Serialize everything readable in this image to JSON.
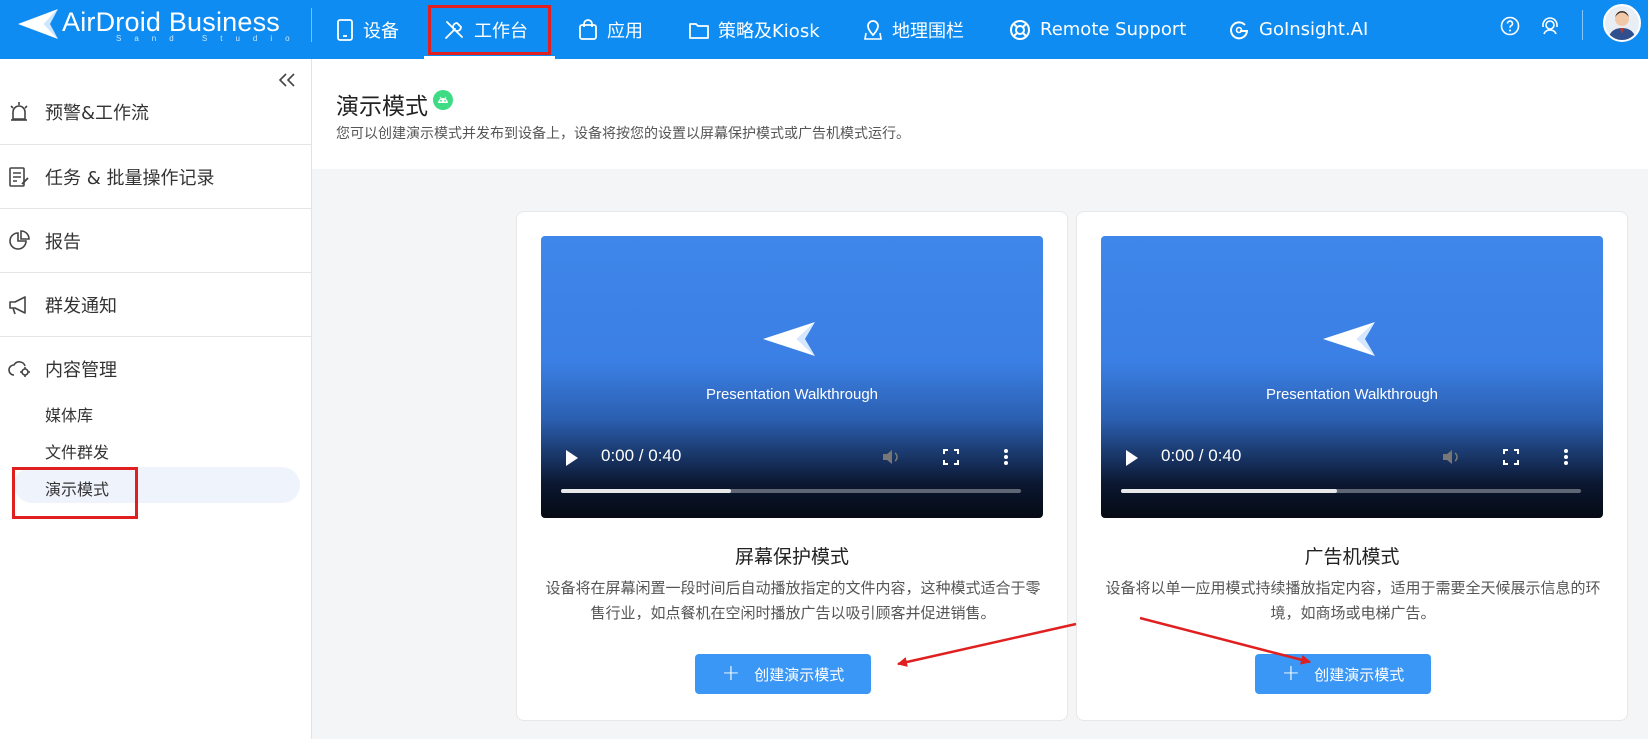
{
  "brand": {
    "name": "AirDroid Business",
    "subtitle": "Sand Studio",
    "color": "#0f8cf2"
  },
  "nav": {
    "items": [
      {
        "label": "设备",
        "icon": "tablet-icon"
      },
      {
        "label": "工作台",
        "icon": "tools-icon",
        "active": true
      },
      {
        "label": "应用",
        "icon": "shopping-bag-icon"
      },
      {
        "label": "策略及Kiosk",
        "icon": "folder-icon"
      },
      {
        "label": "地理围栏",
        "icon": "map-pin-icon"
      },
      {
        "label": "Remote Support",
        "icon": "lifebuoy-icon"
      },
      {
        "label": "GoInsight.AI",
        "icon": "goinsight-icon"
      }
    ],
    "right_icons": [
      "help-icon",
      "support-agent-icon",
      "avatar"
    ]
  },
  "sidebar": {
    "items": [
      {
        "label": "预警&工作流",
        "icon": "alarm-icon"
      },
      {
        "label": "任务 & 批量操作记录",
        "icon": "task-list-icon"
      },
      {
        "label": "报告",
        "icon": "pie-chart-icon"
      },
      {
        "label": "群发通知",
        "icon": "megaphone-icon"
      },
      {
        "label": "内容管理",
        "icon": "cloud-gear-icon"
      }
    ],
    "sub_items": [
      "媒体库",
      "文件群发",
      "演示模式"
    ],
    "active_sub": "演示模式"
  },
  "page": {
    "title": "演示模式",
    "description": "您可以创建演示模式并发布到设备上，设备将按您的设置以屏幕保护模式或广告机模式运行。"
  },
  "cards": [
    {
      "video_caption": "Presentation Walkthrough",
      "time": "0:00 / 0:40",
      "progress": 0.37,
      "title": "屏幕保护模式",
      "description": "设备将在屏幕闲置一段时间后自动播放指定的文件内容，这种模式适合于零售行业，如点餐机在空闲时播放广告以吸引顾客并促进销售。",
      "button": "创建演示模式"
    },
    {
      "video_caption": "Presentation Walkthrough",
      "time": "0:00 / 0:40",
      "progress": 0.47,
      "title": "广告机模式",
      "description": "设备将以单一应用模式持续播放指定内容，适用于需要全天候展示信息的环境，如商场或电梯广告。",
      "button": "创建演示模式"
    }
  ],
  "colors": {
    "accent": "#3b97f6",
    "annotation": "#e02020",
    "android": "#3ddc84"
  }
}
